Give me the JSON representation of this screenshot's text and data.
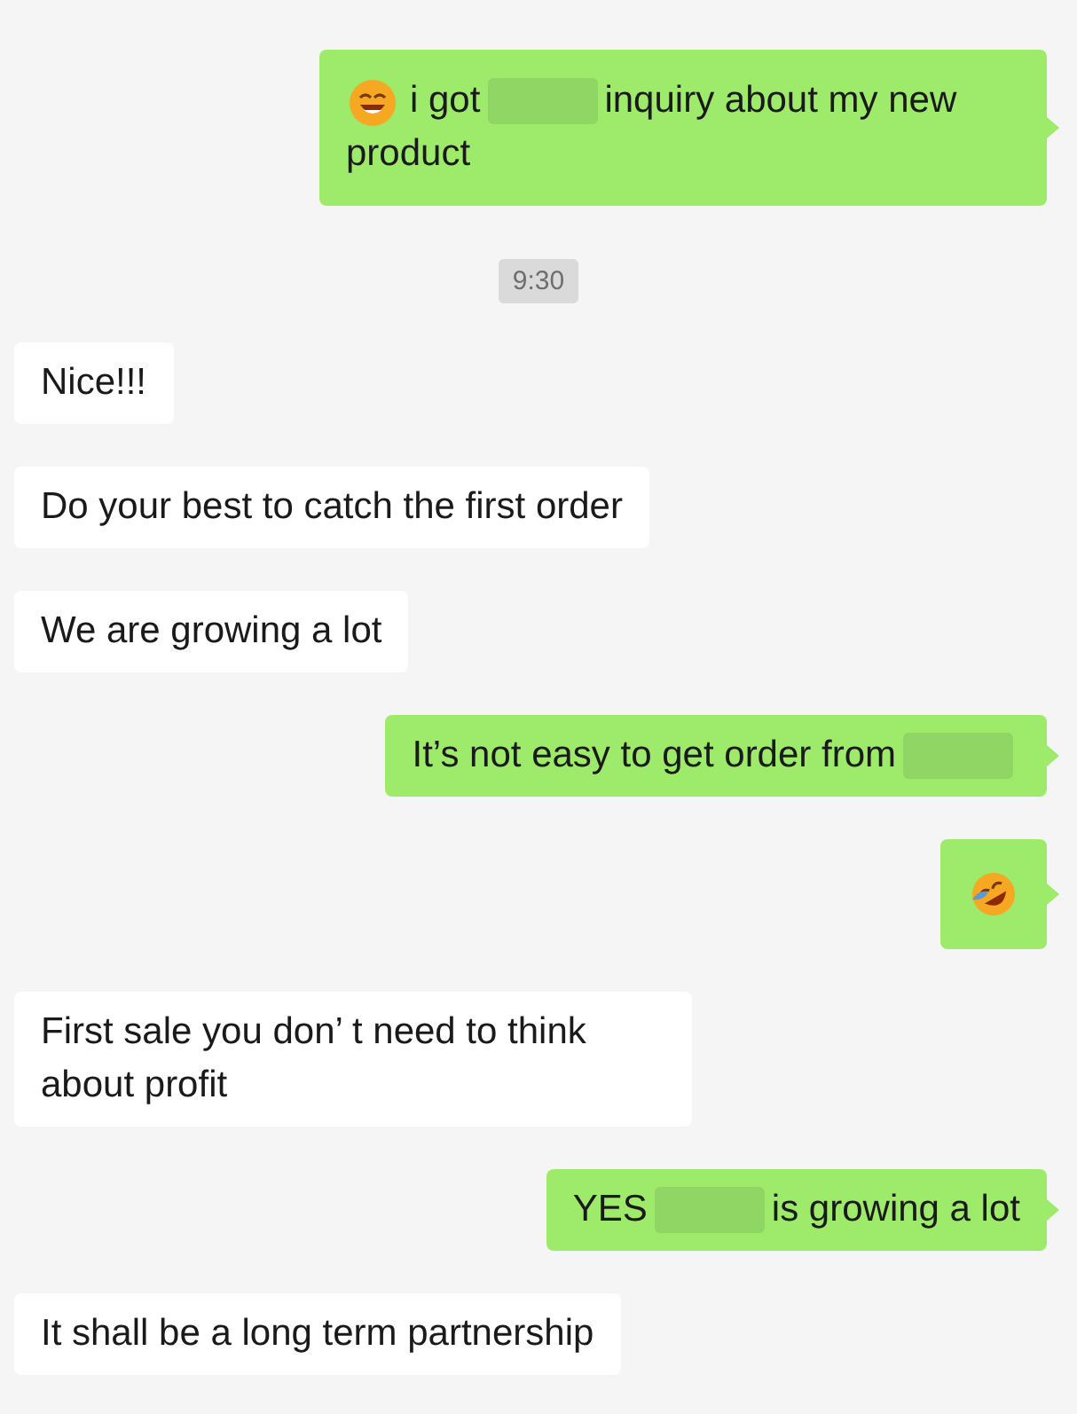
{
  "messages": [
    {
      "kind": "sent",
      "parts": [
        {
          "kind": "grin"
        },
        {
          "kind": "text",
          "text": "i got"
        },
        {
          "kind": "redacted"
        },
        {
          "kind": "text",
          "text": "inquiry about my new"
        },
        {
          "kind": "text",
          "text": "product"
        }
      ]
    },
    {
      "kind": "time",
      "text": "9:30"
    },
    {
      "kind": "received",
      "parts": [
        {
          "kind": "text",
          "text": "Nice!!!"
        }
      ]
    },
    {
      "kind": "received",
      "parts": [
        {
          "kind": "text",
          "text": "Do your best to catch the first order"
        }
      ]
    },
    {
      "kind": "received",
      "parts": [
        {
          "kind": "text",
          "text": "We are growing a lot"
        }
      ]
    },
    {
      "kind": "sent",
      "parts": [
        {
          "kind": "text",
          "text": "It’s not easy to get order from"
        },
        {
          "kind": "redacted"
        }
      ]
    },
    {
      "kind": "sent",
      "parts": [
        {
          "kind": "tears"
        }
      ]
    },
    {
      "kind": "received",
      "parts": [
        {
          "kind": "text",
          "text": "First sale you don’ t need to think about profit"
        }
      ]
    },
    {
      "kind": "sent",
      "parts": [
        {
          "kind": "text",
          "text": "YES"
        },
        {
          "kind": "redacted"
        },
        {
          "kind": "text",
          "text": "is growing a lot"
        }
      ]
    },
    {
      "kind": "received",
      "parts": [
        {
          "kind": "text",
          "text": "It shall be a long term partnership"
        }
      ]
    }
  ]
}
